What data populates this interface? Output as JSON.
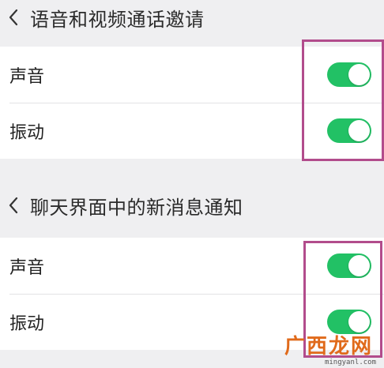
{
  "sections": [
    {
      "title": "语音和视频通话邀请",
      "items": [
        {
          "label": "声音",
          "enabled": true
        },
        {
          "label": "振动",
          "enabled": true
        }
      ]
    },
    {
      "title": "聊天界面中的新消息通知",
      "items": [
        {
          "label": "声音",
          "enabled": true
        },
        {
          "label": "振动",
          "enabled": true
        }
      ]
    }
  ],
  "colors": {
    "toggle_on": "#22c165",
    "highlight_border": "#b24c8c",
    "background": "#efeff1"
  },
  "watermark": {
    "main": "广西龙网",
    "sub": "mingyanl.com"
  }
}
